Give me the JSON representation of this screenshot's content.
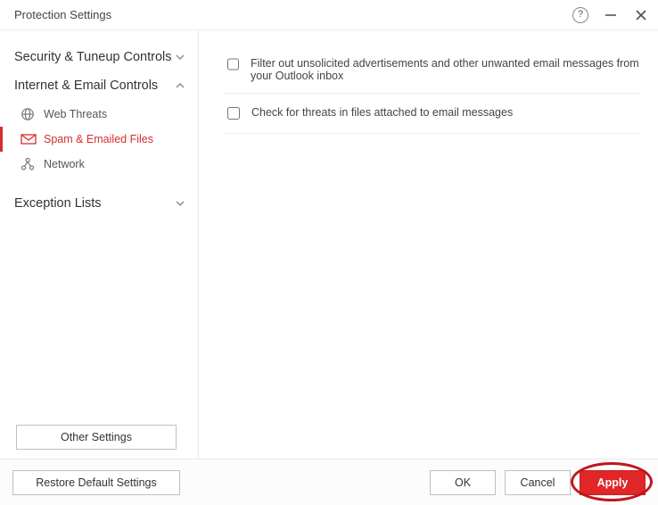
{
  "title": "Protection Settings",
  "sidebar": {
    "sections": [
      {
        "label": "Security & Tuneup Controls",
        "expanded": false
      },
      {
        "label": "Internet & Email Controls",
        "expanded": true,
        "items": [
          {
            "label": "Web Threats",
            "icon": "globe-icon",
            "active": false
          },
          {
            "label": "Spam & Emailed Files",
            "icon": "mail-icon",
            "active": true
          },
          {
            "label": "Network",
            "icon": "network-icon",
            "active": false
          }
        ]
      },
      {
        "label": "Exception Lists",
        "expanded": false
      }
    ]
  },
  "options": [
    {
      "label": "Filter out unsolicited advertisements and other unwanted email messages from your Outlook inbox",
      "checked": false
    },
    {
      "label": "Check for threats in files attached to email messages",
      "checked": false
    }
  ],
  "buttons": {
    "other": "Other Settings",
    "restore": "Restore Default Settings",
    "ok": "OK",
    "cancel": "Cancel",
    "apply": "Apply"
  },
  "annotation": {
    "highlight": "apply-button"
  }
}
